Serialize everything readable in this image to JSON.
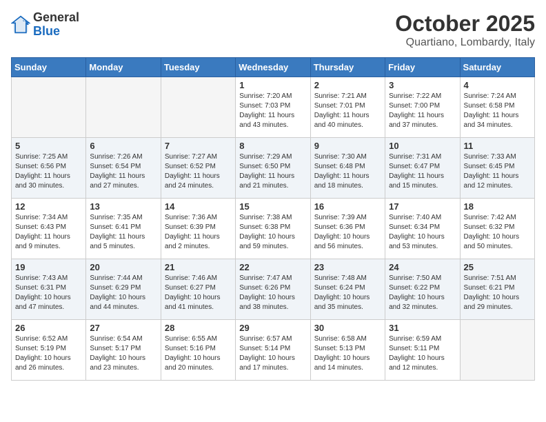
{
  "header": {
    "logo_general": "General",
    "logo_blue": "Blue",
    "title": "October 2025",
    "subtitle": "Quartiano, Lombardy, Italy"
  },
  "calendar": {
    "days_of_week": [
      "Sunday",
      "Monday",
      "Tuesday",
      "Wednesday",
      "Thursday",
      "Friday",
      "Saturday"
    ],
    "weeks": [
      [
        {
          "day": "",
          "info": ""
        },
        {
          "day": "",
          "info": ""
        },
        {
          "day": "",
          "info": ""
        },
        {
          "day": "1",
          "info": "Sunrise: 7:20 AM\nSunset: 7:03 PM\nDaylight: 11 hours\nand 43 minutes."
        },
        {
          "day": "2",
          "info": "Sunrise: 7:21 AM\nSunset: 7:01 PM\nDaylight: 11 hours\nand 40 minutes."
        },
        {
          "day": "3",
          "info": "Sunrise: 7:22 AM\nSunset: 7:00 PM\nDaylight: 11 hours\nand 37 minutes."
        },
        {
          "day": "4",
          "info": "Sunrise: 7:24 AM\nSunset: 6:58 PM\nDaylight: 11 hours\nand 34 minutes."
        }
      ],
      [
        {
          "day": "5",
          "info": "Sunrise: 7:25 AM\nSunset: 6:56 PM\nDaylight: 11 hours\nand 30 minutes."
        },
        {
          "day": "6",
          "info": "Sunrise: 7:26 AM\nSunset: 6:54 PM\nDaylight: 11 hours\nand 27 minutes."
        },
        {
          "day": "7",
          "info": "Sunrise: 7:27 AM\nSunset: 6:52 PM\nDaylight: 11 hours\nand 24 minutes."
        },
        {
          "day": "8",
          "info": "Sunrise: 7:29 AM\nSunset: 6:50 PM\nDaylight: 11 hours\nand 21 minutes."
        },
        {
          "day": "9",
          "info": "Sunrise: 7:30 AM\nSunset: 6:48 PM\nDaylight: 11 hours\nand 18 minutes."
        },
        {
          "day": "10",
          "info": "Sunrise: 7:31 AM\nSunset: 6:47 PM\nDaylight: 11 hours\nand 15 minutes."
        },
        {
          "day": "11",
          "info": "Sunrise: 7:33 AM\nSunset: 6:45 PM\nDaylight: 11 hours\nand 12 minutes."
        }
      ],
      [
        {
          "day": "12",
          "info": "Sunrise: 7:34 AM\nSunset: 6:43 PM\nDaylight: 11 hours\nand 9 minutes."
        },
        {
          "day": "13",
          "info": "Sunrise: 7:35 AM\nSunset: 6:41 PM\nDaylight: 11 hours\nand 5 minutes."
        },
        {
          "day": "14",
          "info": "Sunrise: 7:36 AM\nSunset: 6:39 PM\nDaylight: 11 hours\nand 2 minutes."
        },
        {
          "day": "15",
          "info": "Sunrise: 7:38 AM\nSunset: 6:38 PM\nDaylight: 10 hours\nand 59 minutes."
        },
        {
          "day": "16",
          "info": "Sunrise: 7:39 AM\nSunset: 6:36 PM\nDaylight: 10 hours\nand 56 minutes."
        },
        {
          "day": "17",
          "info": "Sunrise: 7:40 AM\nSunset: 6:34 PM\nDaylight: 10 hours\nand 53 minutes."
        },
        {
          "day": "18",
          "info": "Sunrise: 7:42 AM\nSunset: 6:32 PM\nDaylight: 10 hours\nand 50 minutes."
        }
      ],
      [
        {
          "day": "19",
          "info": "Sunrise: 7:43 AM\nSunset: 6:31 PM\nDaylight: 10 hours\nand 47 minutes."
        },
        {
          "day": "20",
          "info": "Sunrise: 7:44 AM\nSunset: 6:29 PM\nDaylight: 10 hours\nand 44 minutes."
        },
        {
          "day": "21",
          "info": "Sunrise: 7:46 AM\nSunset: 6:27 PM\nDaylight: 10 hours\nand 41 minutes."
        },
        {
          "day": "22",
          "info": "Sunrise: 7:47 AM\nSunset: 6:26 PM\nDaylight: 10 hours\nand 38 minutes."
        },
        {
          "day": "23",
          "info": "Sunrise: 7:48 AM\nSunset: 6:24 PM\nDaylight: 10 hours\nand 35 minutes."
        },
        {
          "day": "24",
          "info": "Sunrise: 7:50 AM\nSunset: 6:22 PM\nDaylight: 10 hours\nand 32 minutes."
        },
        {
          "day": "25",
          "info": "Sunrise: 7:51 AM\nSunset: 6:21 PM\nDaylight: 10 hours\nand 29 minutes."
        }
      ],
      [
        {
          "day": "26",
          "info": "Sunrise: 6:52 AM\nSunset: 5:19 PM\nDaylight: 10 hours\nand 26 minutes."
        },
        {
          "day": "27",
          "info": "Sunrise: 6:54 AM\nSunset: 5:17 PM\nDaylight: 10 hours\nand 23 minutes."
        },
        {
          "day": "28",
          "info": "Sunrise: 6:55 AM\nSunset: 5:16 PM\nDaylight: 10 hours\nand 20 minutes."
        },
        {
          "day": "29",
          "info": "Sunrise: 6:57 AM\nSunset: 5:14 PM\nDaylight: 10 hours\nand 17 minutes."
        },
        {
          "day": "30",
          "info": "Sunrise: 6:58 AM\nSunset: 5:13 PM\nDaylight: 10 hours\nand 14 minutes."
        },
        {
          "day": "31",
          "info": "Sunrise: 6:59 AM\nSunset: 5:11 PM\nDaylight: 10 hours\nand 12 minutes."
        },
        {
          "day": "",
          "info": ""
        }
      ]
    ]
  }
}
